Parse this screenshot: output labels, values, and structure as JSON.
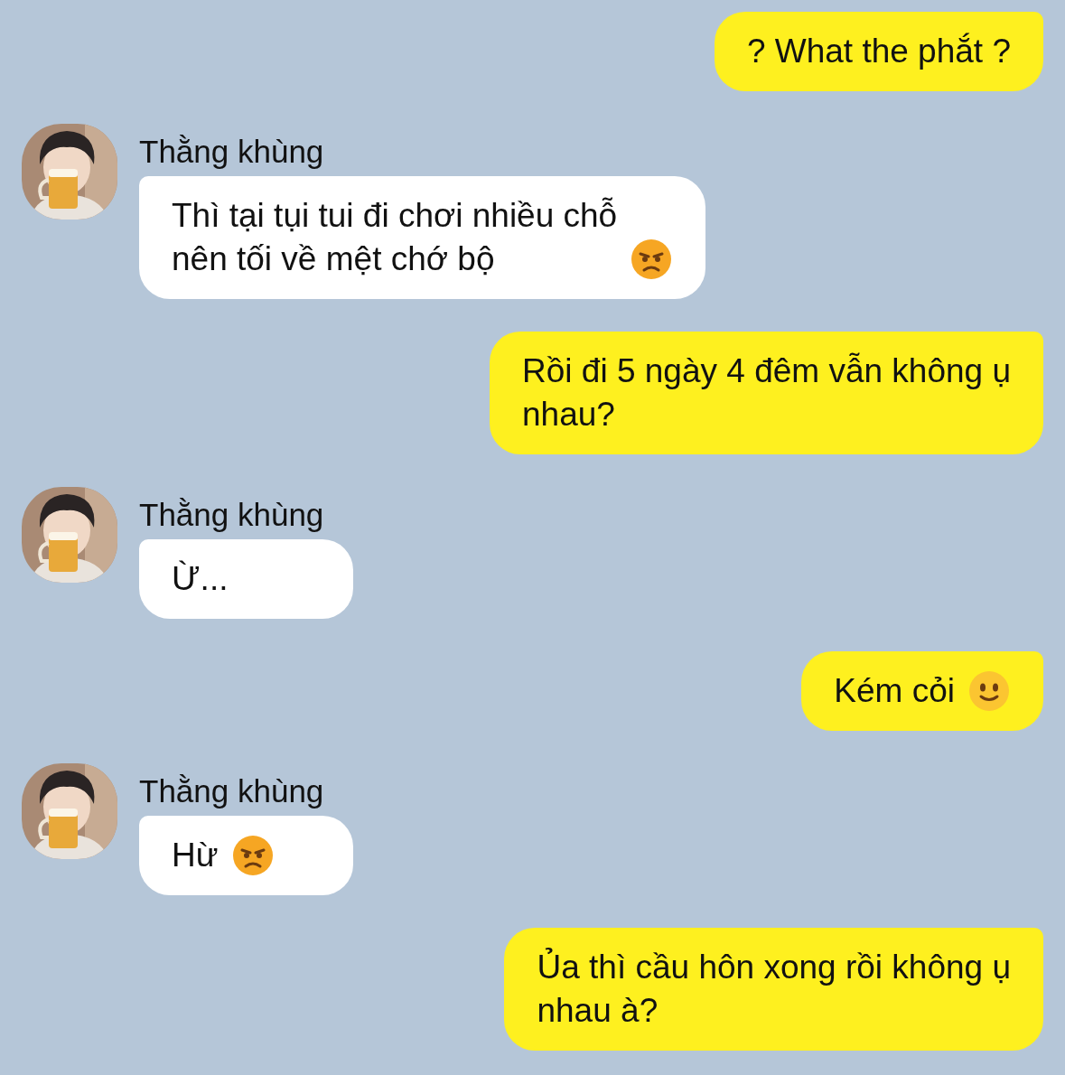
{
  "messages": [
    {
      "kind": "outgoing",
      "text": "? What the phắt ?"
    },
    {
      "kind": "incoming",
      "sender": "Thằng khùng",
      "text": "Thì tại tụi tui đi chơi nhiều chỗ\nnên tối về mệt chớ bộ",
      "emoji": {
        "kind": "angry"
      }
    },
    {
      "kind": "outgoing",
      "text": "Rồi đi 5 ngày 4 đêm vẫn không ụ\nnhau?"
    },
    {
      "kind": "incoming",
      "sender": "Thằng khùng",
      "text": "Ừ..."
    },
    {
      "kind": "outgoing",
      "text": "Kém cỏi",
      "emoji": {
        "kind": "smile"
      }
    },
    {
      "kind": "incoming",
      "sender": "Thằng khùng",
      "text": "Hừ",
      "emoji": {
        "kind": "angry"
      }
    },
    {
      "kind": "outgoing",
      "text": "Ủa thì cầu hôn xong rồi không ụ\nnhau à?"
    }
  ]
}
